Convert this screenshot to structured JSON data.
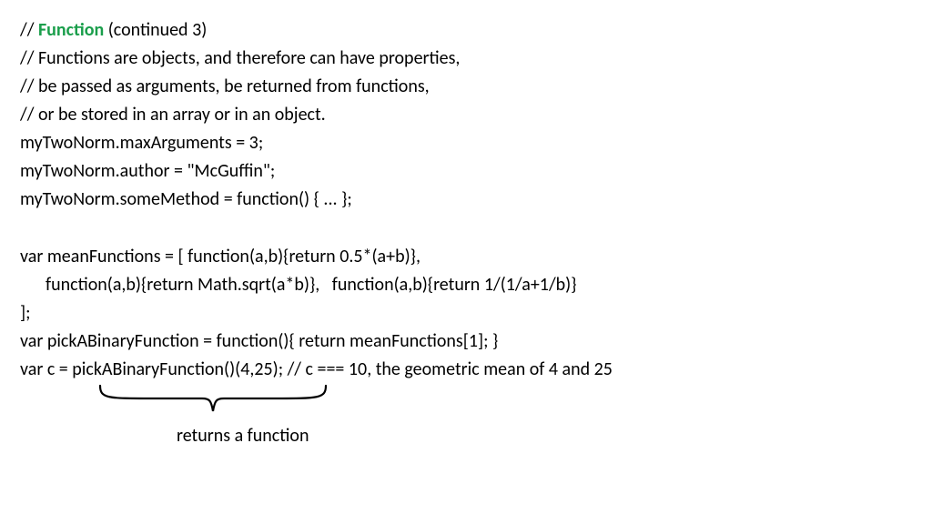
{
  "lines": {
    "l1_pre": "// ",
    "l1_kw": "Function",
    "l1_post": " (continued 3)",
    "l2": "// Functions are objects, and therefore can have properties,",
    "l3": "// be passed as arguments, be returned from functions,",
    "l4": "// or be stored in an array or in an object.",
    "l5": "myTwoNorm.maxArguments = 3;",
    "l6": "myTwoNorm.author = \"McGuffin\";",
    "l7": "myTwoNorm.someMethod = function() { ... };",
    "l8": "var meanFunctions = [ function(a,b){return 0.5*(a+b)},",
    "l9": "function(a,b){return Math.sqrt(a*b)},   function(a,b){return 1/(1/a+1/b)}",
    "l10": "];",
    "l11": "var pickABinaryFunction = function(){ return meanFunctions[1]; }",
    "l12": "var c = pickABinaryFunction()(4,25); // c === 10, the geometric mean of 4 and 25"
  },
  "annotation": {
    "label": "returns a function"
  }
}
